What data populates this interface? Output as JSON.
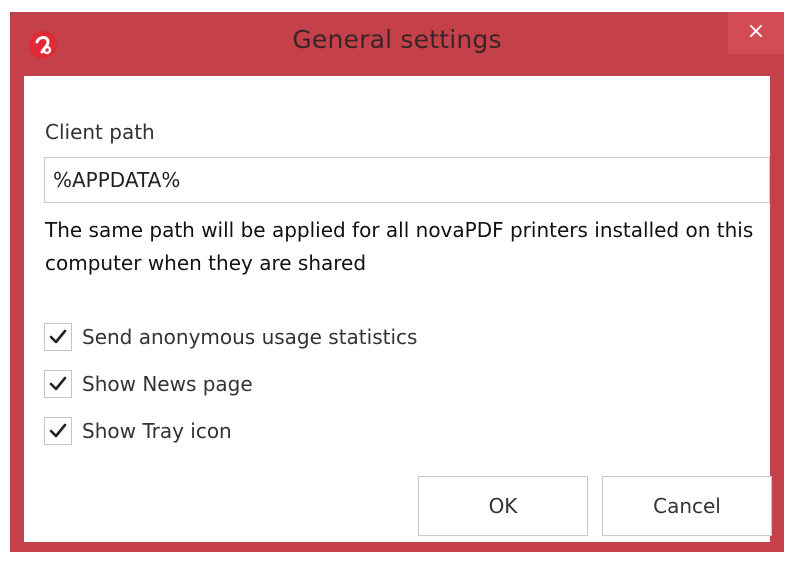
{
  "window": {
    "title": "General settings",
    "close_glyph": "×",
    "app_icon": "novapdf-logo-icon",
    "accent_color": "#c5414a"
  },
  "client_path": {
    "label": "Client path",
    "value": "%APPDATA%"
  },
  "hint": "The same path will be applied for all novaPDF printers installed on this computer when they are shared",
  "options": [
    {
      "label": "Send anonymous usage statistics",
      "checked": true
    },
    {
      "label": "Show News page",
      "checked": true
    },
    {
      "label": "Show Tray icon",
      "checked": true
    }
  ],
  "buttons": {
    "ok": "OK",
    "cancel": "Cancel"
  }
}
